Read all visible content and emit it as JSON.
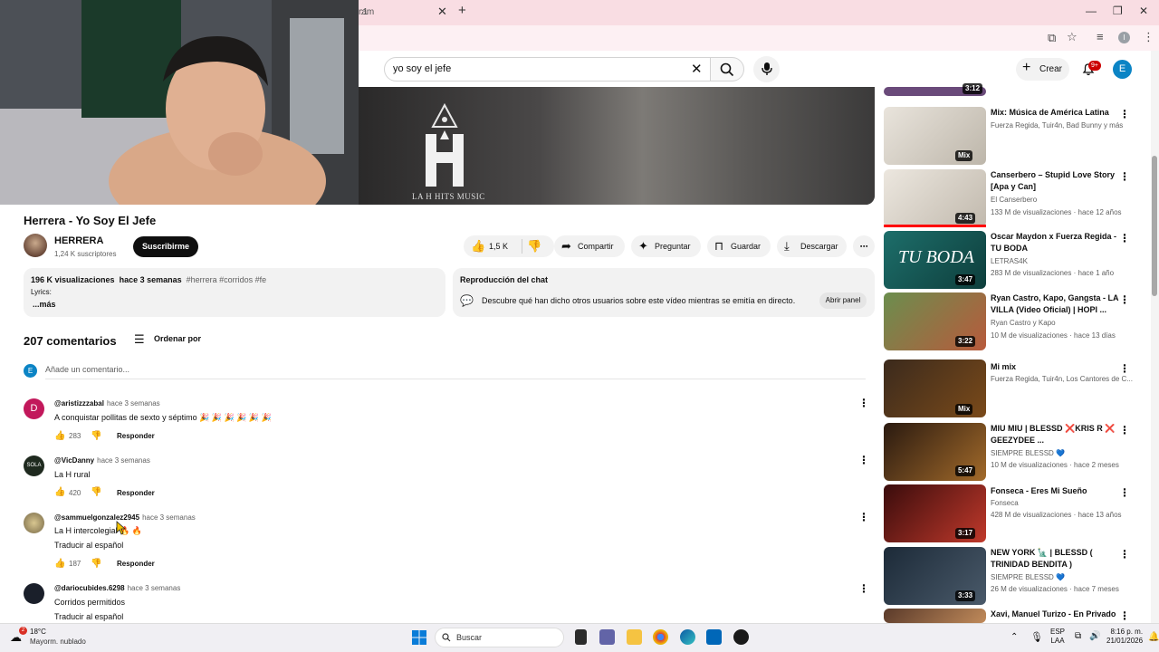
{
  "browser": {
    "tab_fragment": "ram",
    "address_fragment": ":1"
  },
  "header": {
    "search_value": "yo soy el jefe",
    "create_label": "Crear",
    "notifications_badge": "9+",
    "avatar_letter": "E"
  },
  "video": {
    "logo_text": "LA H HITS MUSIC",
    "title": "Herrera - Yo Soy El Jefe",
    "channel": "HERRERA",
    "subscribers": "1,24 K suscriptores",
    "subscribe_label": "Suscribirme",
    "likes": "1,5 K",
    "share_label": "Compartir",
    "ask_label": "Preguntar",
    "save_label": "Guardar",
    "download_label": "Descargar"
  },
  "description": {
    "views": "196 K visualizaciones",
    "age": "hace 3 semanas",
    "tags": "#herrera #corridos #fe",
    "lyrics": "Lyrics:",
    "more": "...más"
  },
  "chat_replay": {
    "title": "Reproducción del chat",
    "text": "Descubre qué han dicho otros usuarios sobre este vídeo mientras se emitía en directo.",
    "button": "Abrir panel"
  },
  "comments": {
    "count_label": "207 comentarios",
    "sort_label": "Ordenar por",
    "add_placeholder": "Añade un comentario...",
    "user_initial": "E",
    "reply_label": "Responder",
    "translate_label": "Traducir al español",
    "items": [
      {
        "user": "@aristizzzabal",
        "time": "hace 3 semanas",
        "text": "A conquistar pollitas de sexto y séptimo 🎉 🎉 🎉 🎉 🎉 🎉",
        "likes": "283",
        "initial": "D"
      },
      {
        "user": "@VicDanny",
        "time": "hace 3 semanas",
        "text": "La H rural",
        "likes": "420",
        "initial": "SOLA"
      },
      {
        "user": "@sammuelgonzalez2945",
        "time": "hace 3 semanas",
        "text": "La H intercolegial 🔥 🔥",
        "likes": "187",
        "initial": ""
      },
      {
        "user": "@dariocubides.6298",
        "time": "hace 3 semanas",
        "text": "Corridos permitidos",
        "likes": "",
        "initial": ""
      }
    ]
  },
  "sidebar": {
    "top_duration": "3:12",
    "items": [
      {
        "title": "Mix: Música de América Latina",
        "channel": "Fuerza Regida, Tuir4n, Bad Bunny y más",
        "views": "",
        "duration": "Mix",
        "verified": false
      },
      {
        "title": "Canserbero – Stupid Love Story [Apa y Can]",
        "channel": "El Canserbero",
        "views": "133 M de visualizaciones · hace 12 años",
        "duration": "4:43",
        "verified": true
      },
      {
        "title": "Oscar Maydon x Fuerza Regida - TU BODA",
        "channel": "LETRAS4K",
        "views": "283 M de visualizaciones · hace 1 año",
        "duration": "3:47",
        "verified": true
      },
      {
        "title": "Ryan Castro, Kapo, Gangsta - LA VILLA (Video Oficial) | HOPI ...",
        "channel": "Ryan Castro y Kapo",
        "views": "10 M de visualizaciones · hace 13 días",
        "duration": "3:22",
        "verified": true
      },
      {
        "title": "Mi mix",
        "channel": "Fuerza Regida, Tuir4n, Los Cantores de C...",
        "views": "",
        "duration": "Mix",
        "verified": false
      },
      {
        "title": "MIU MIU | BLESSD ❌KRIS R ❌ GEEZYDEE ...",
        "channel": "SIEMPRE BLESSD 💙",
        "views": "10 M de visualizaciones · hace 2 meses",
        "duration": "5:47",
        "verified": true
      },
      {
        "title": "Fonseca - Eres Mi Sueño",
        "channel": "Fonseca",
        "views": "428 M de visualizaciones · hace 13 años",
        "duration": "3:17",
        "verified": true
      },
      {
        "title": "NEW YORK 🗽 | BLESSD ( TRINIDAD BENDITA )",
        "channel": "SIEMPRE BLESSD 💙",
        "views": "26 M de visualizaciones · hace 7 meses",
        "duration": "3:33",
        "verified": true
      },
      {
        "title": "Xavi, Manuel Turizo - En Privado",
        "channel": "",
        "views": "",
        "duration": "",
        "verified": false
      }
    ]
  },
  "taskbar": {
    "weather_temp": "18°C",
    "weather_desc": "Mayorm. nublado",
    "weather_badge": "2",
    "search_label": "Buscar",
    "lang_1": "ESP",
    "lang_2": "LAA",
    "time": "8:16 p. m.",
    "date": "21/01/2026"
  },
  "colors": {
    "tabstrip": "#f9dde3",
    "accent_red": "#ff0000",
    "avatar_blue": "#0b84c5"
  }
}
